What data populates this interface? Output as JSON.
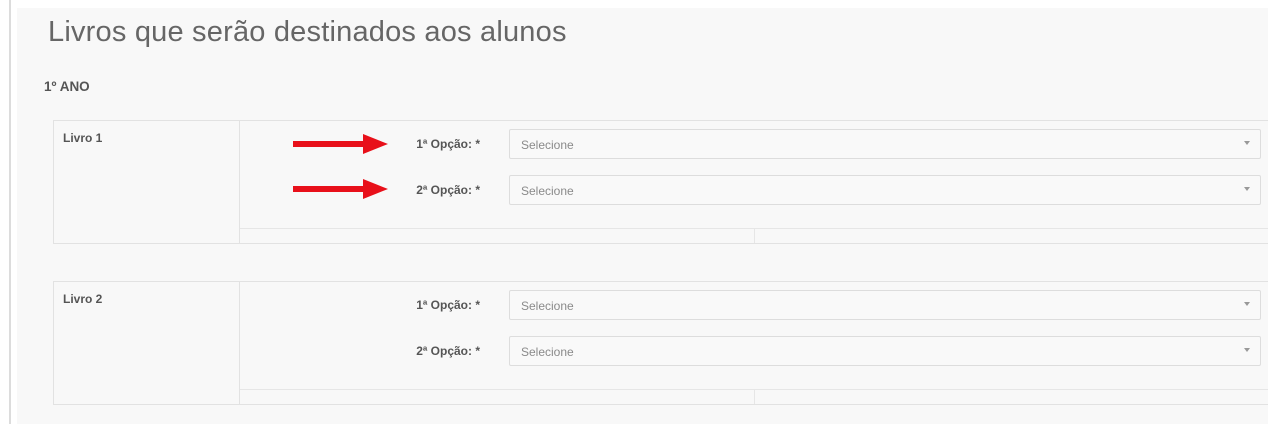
{
  "page": {
    "title": "Livros que serão destinados aos alunos"
  },
  "year": {
    "label": "1º ANO"
  },
  "books": [
    {
      "name": "Livro 1",
      "options": [
        {
          "label": "1ª Opção: *",
          "value": "Selecione"
        },
        {
          "label": "2ª Opção: *",
          "value": "Selecione"
        }
      ]
    },
    {
      "name": "Livro 2",
      "options": [
        {
          "label": "1ª Opção: *",
          "value": "Selecione"
        },
        {
          "label": "2ª Opção: *",
          "value": "Selecione"
        }
      ]
    }
  ],
  "icons": {
    "select_indicator": "chevron-down-icon",
    "annotation": "arrow-right-icon"
  },
  "colors": {
    "annotation_arrow": "#e8101a"
  }
}
